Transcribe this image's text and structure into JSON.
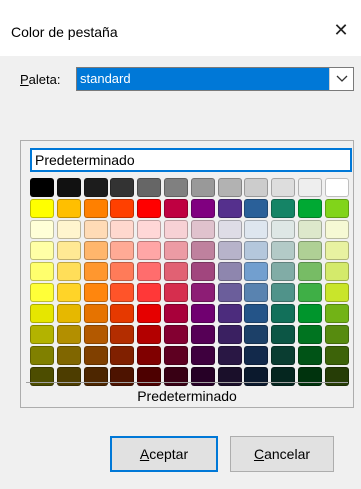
{
  "dialog": {
    "title": "Color de pestaña",
    "close_icon": "close-icon"
  },
  "palette": {
    "label_underlined": "P",
    "label_rest": "aleta:",
    "selected": "standard"
  },
  "color_name": "Predeterminado",
  "swatches": [
    [
      "#000000",
      "#111111",
      "#1c1c1c",
      "#333333",
      "#666666",
      "#808080",
      "#999999",
      "#b2b2b2",
      "#cccccc",
      "#dddddd",
      "#eeeeee",
      "#ffffff"
    ],
    [
      "#ffff00",
      "#ffbf00",
      "#ff8000",
      "#ff4000",
      "#ff0000",
      "#bf0041",
      "#800080",
      "#55308d",
      "#2a6099",
      "#158466",
      "#00a933",
      "#81d41a"
    ],
    [
      "#ffffd7",
      "#fff5ce",
      "#ffdbb6",
      "#ffd8ce",
      "#ffd7d7",
      "#f7d1d5",
      "#e0c2cd",
      "#dedce6",
      "#dee6ef",
      "#dee7e5",
      "#dde8cb",
      "#f6f9d4"
    ],
    [
      "#ffffa6",
      "#ffe994",
      "#ffb66c",
      "#ffaa95",
      "#ffa6a6",
      "#ec9ba4",
      "#bf819e",
      "#b7b3ca",
      "#b4c7dc",
      "#b3cac7",
      "#afd095",
      "#e8f2a1"
    ],
    [
      "#ffff6d",
      "#ffde59",
      "#ff972f",
      "#ff7b59",
      "#ff6d6d",
      "#e16173",
      "#a1467e",
      "#8e86ae",
      "#729fcf",
      "#81aca6",
      "#77bc65",
      "#d4ea6b"
    ],
    [
      "#ffff38",
      "#ffd428",
      "#ff860d",
      "#ff5429",
      "#ff3838",
      "#d62e4e",
      "#8d1d75",
      "#6b5e9b",
      "#5983b0",
      "#50938a",
      "#3faf46",
      "#c9e52b"
    ],
    [
      "#e6e600",
      "#e6b800",
      "#e67300",
      "#e63900",
      "#e60000",
      "#a8003a",
      "#700070",
      "#4c2c7d",
      "#245488",
      "#12705a",
      "#00952c",
      "#72b316"
    ],
    [
      "#b3b300",
      "#b38f00",
      "#b35900",
      "#b32d00",
      "#b30000",
      "#830031",
      "#560056",
      "#3a2061",
      "#1c4068",
      "#0c5645",
      "#007420",
      "#578b0f"
    ],
    [
      "#808000",
      "#806600",
      "#804000",
      "#802000",
      "#800000",
      "#5e0021",
      "#3e003e",
      "#291744",
      "#12294b",
      "#0a3d31",
      "#005316",
      "#3d6309"
    ],
    [
      "#4d4d00",
      "#4d3d00",
      "#4d2600",
      "#4d1300",
      "#4d0000",
      "#380014",
      "#260026",
      "#1a0f2a",
      "#0b192d",
      "#05261f",
      "#00330d",
      "#263d06"
    ]
  ],
  "default_button": "Predeterminado",
  "buttons": {
    "ok_underlined": "A",
    "ok_rest": "ceptar",
    "cancel_underlined": "C",
    "cancel_rest": "ancelar"
  }
}
